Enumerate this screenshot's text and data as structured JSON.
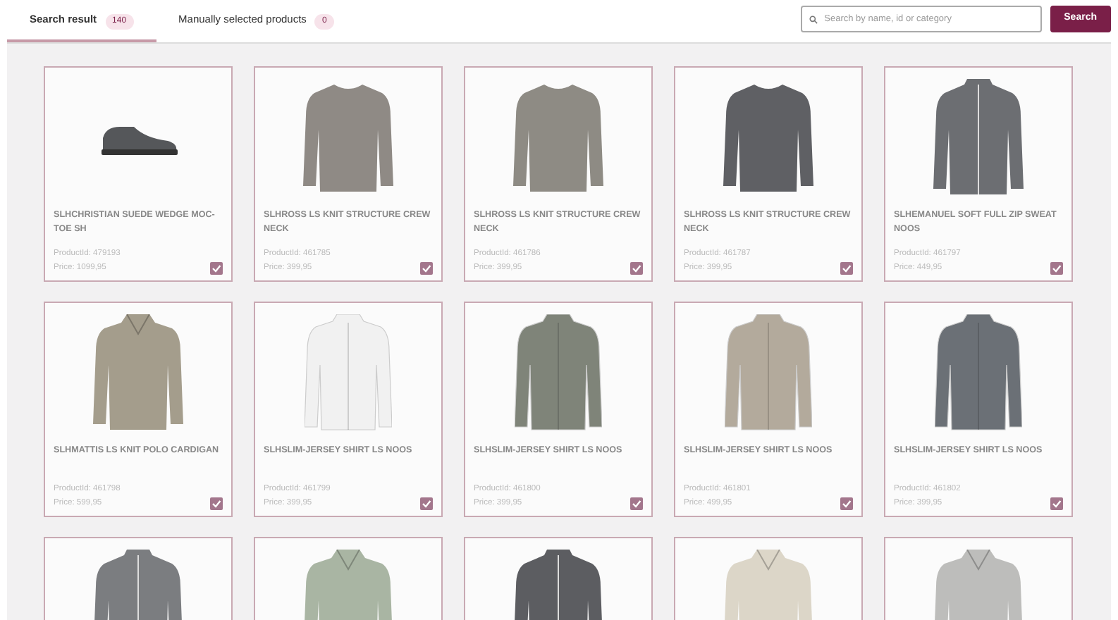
{
  "tabs": [
    {
      "label": "Search result",
      "count": "140",
      "selected": true
    },
    {
      "label": "Manually selected products",
      "count": "0",
      "selected": false
    }
  ],
  "search": {
    "placeholder": "Search by name, id or category",
    "button": "Search"
  },
  "products": [
    {
      "kind": "shoe",
      "color": "#55575a",
      "name": "SLHCHRISTIAN SUEDE WEDGE MOC-TOE SH",
      "product_id": "ProductId: 479193",
      "price": "Price: 1099,95",
      "checked": true
    },
    {
      "kind": "sweater",
      "color": "#8f8a85",
      "name": "SLHROSS LS KNIT STRUCTURE CREW NECK",
      "product_id": "ProductId: 461785",
      "price": "Price: 399,95",
      "checked": true
    },
    {
      "kind": "sweater",
      "color": "#8e8b84",
      "name": "SLHROSS LS KNIT STRUCTURE CREW NECK",
      "product_id": "ProductId: 461786",
      "price": "Price: 399,95",
      "checked": true
    },
    {
      "kind": "sweater",
      "color": "#5f6064",
      "name": "SLHROSS LS KNIT STRUCTURE CREW NECK",
      "product_id": "ProductId: 461787",
      "price": "Price: 399,95",
      "checked": true
    },
    {
      "kind": "zip",
      "color": "#6c6e72",
      "name": "SLHEMANUEL SOFT FULL ZIP SWEAT NOOS",
      "product_id": "ProductId: 461797",
      "price": "Price: 449,95",
      "checked": true
    },
    {
      "kind": "polo",
      "color": "#a49d8c",
      "name": "SLHMATTIS LS KNIT POLO CARDIGAN",
      "product_id": "ProductId: 461798",
      "price": "Price: 599,95",
      "checked": true
    },
    {
      "kind": "shirt",
      "color": "#f1f1f1",
      "name": "SLHSLIM-JERSEY SHIRT LS NOOS",
      "product_id": "ProductId: 461799",
      "price": "Price: 399,95",
      "checked": true
    },
    {
      "kind": "shirt",
      "color": "#7f8479",
      "name": "SLHSLIM-JERSEY SHIRT LS NOOS",
      "product_id": "ProductId: 461800",
      "price": "Price: 399,95",
      "checked": true
    },
    {
      "kind": "shirt",
      "color": "#b3aa9c",
      "name": "SLHSLIM-JERSEY SHIRT LS NOOS",
      "product_id": "ProductId: 461801",
      "price": "Price: 499,95",
      "checked": true
    },
    {
      "kind": "shirt",
      "color": "#6b7076",
      "name": "SLHSLIM-JERSEY SHIRT LS NOOS",
      "product_id": "ProductId: 461802",
      "price": "Price: 399,95",
      "checked": true
    },
    {
      "kind": "zip",
      "color": "#7b7d80"
    },
    {
      "kind": "polo",
      "color": "#a9b5a3"
    },
    {
      "kind": "zip",
      "color": "#5c5d61"
    },
    {
      "kind": "polo",
      "color": "#dcd6c8"
    },
    {
      "kind": "polo",
      "color": "#bdbdbb"
    }
  ]
}
